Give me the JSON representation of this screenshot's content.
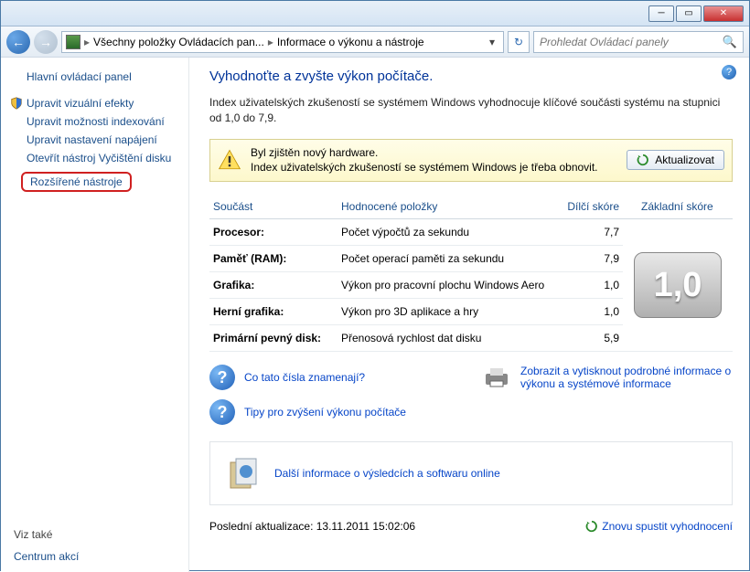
{
  "window": {
    "breadcrumb1": "Všechny položky Ovládacích pan...",
    "breadcrumb2": "Informace o výkonu a nástroje",
    "search_placeholder": "Prohledat Ovládací panely"
  },
  "sidebar": {
    "home": "Hlavní ovládací panel",
    "tasks": [
      "Upravit vizuální efekty",
      "Upravit možnosti indexování",
      "Upravit nastavení napájení",
      "Otevřít nástroj Vyčištění disku",
      "Rozšířené nástroje"
    ],
    "see_also_label": "Viz také",
    "see_also_link": "Centrum akcí"
  },
  "main": {
    "title": "Vyhodnoťte a zvyšte výkon počítače.",
    "intro": "Index uživatelských zkušeností se systémem Windows vyhodnocuje klíčové součásti systému na stupnici od 1,0 do 7,9.",
    "notice_line1": "Byl zjištěn nový hardware.",
    "notice_line2": "Index uživatelských zkušeností se systémem Windows je třeba obnovit.",
    "update_button": "Aktualizovat",
    "headers": {
      "component": "Součást",
      "rated": "Hodnocené položky",
      "subscore": "Dílčí skóre",
      "base": "Základní skóre"
    },
    "rows": [
      {
        "label": "Procesor:",
        "desc": "Počet výpočtů za sekundu",
        "score": "7,7"
      },
      {
        "label": "Paměť (RAM):",
        "desc": "Počet operací paměti za sekundu",
        "score": "7,9"
      },
      {
        "label": "Grafika:",
        "desc": "Výkon pro pracovní plochu Windows Aero",
        "score": "1,0"
      },
      {
        "label": "Herní grafika:",
        "desc": "Výkon pro 3D aplikace a hry",
        "score": "1,0"
      },
      {
        "label": "Primární pevný disk:",
        "desc": "Přenosová rychlost dat disku",
        "score": "5,9"
      }
    ],
    "base_score": "1,0",
    "link_meaning": "Co tato čísla znamenají?",
    "link_tips": "Tipy pro zvýšení výkonu počítače",
    "link_print": "Zobrazit a vytisknout podrobné informace o výkonu a systémové informace",
    "link_online": "Další informace o výsledcích a softwaru online",
    "last_update_label": "Poslední aktualizace:",
    "last_update_value": "13.11.2011 15:02:06",
    "rerun": "Znovu spustit vyhodnocení"
  }
}
